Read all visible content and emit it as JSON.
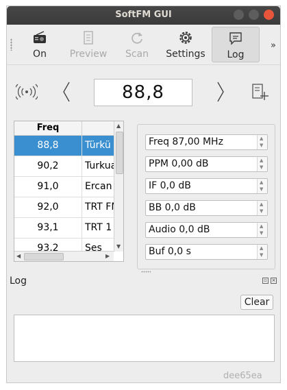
{
  "window": {
    "title": "SoftFM GUI"
  },
  "toolbar": {
    "buttons": [
      {
        "label": "On",
        "icon": "radio-icon"
      },
      {
        "label": "Preview",
        "icon": "preview-icon"
      },
      {
        "label": "Scan",
        "icon": "refresh-icon"
      },
      {
        "label": "Settings",
        "icon": "gear-icon"
      },
      {
        "label": "Log",
        "icon": "message-icon"
      }
    ],
    "overflow": "»"
  },
  "tuner": {
    "frequency": "88,8",
    "prev": "〈",
    "next": "〉"
  },
  "stations": {
    "header": "Freq",
    "rows": [
      {
        "freq": "88,8",
        "name": "Türkü"
      },
      {
        "freq": "90,2",
        "name": "Turkua"
      },
      {
        "freq": "91,0",
        "name": "Ercan"
      },
      {
        "freq": "92,0",
        "name": "TRT FM"
      },
      {
        "freq": "93,1",
        "name": "TRT 1"
      },
      {
        "freq": "93,2",
        "name": "Ses"
      }
    ]
  },
  "status": {
    "freq": "Freq 87,00 MHz",
    "ppm": "PPM 0,00 dB",
    "if": "IF 0,0 dB",
    "bb": "BB 0,0 dB",
    "audio": "Audio 0,0 dB",
    "buf": "Buf 0,0 s"
  },
  "log": {
    "title": "Log",
    "clear_label": "Clear",
    "content": ""
  },
  "watermark": "dee65ea",
  "colors": {
    "selection": "#3a8fd0",
    "titlebar": "#3f3f3f",
    "close": "#e8553b"
  }
}
